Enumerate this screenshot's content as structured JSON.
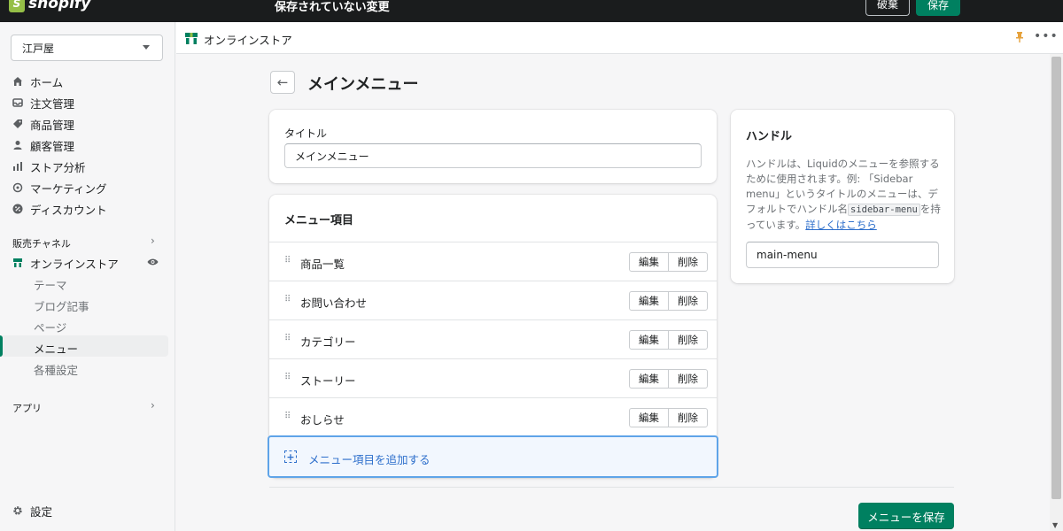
{
  "topbar": {
    "logo_text": "shopify",
    "logo_mark": "S",
    "unsaved_text": "保存されていない変更",
    "discard_label": "破棄",
    "save_label": "保存"
  },
  "sidebar": {
    "store_name": "江戸屋",
    "items": [
      {
        "label": "ホーム",
        "icon": "home-icon"
      },
      {
        "label": "注文管理",
        "icon": "inbox-icon"
      },
      {
        "label": "商品管理",
        "icon": "tag-icon"
      },
      {
        "label": "顧客管理",
        "icon": "person-icon"
      },
      {
        "label": "ストア分析",
        "icon": "bar-chart-icon"
      },
      {
        "label": "マーケティング",
        "icon": "target-icon"
      },
      {
        "label": "ディスカウント",
        "icon": "discount-icon"
      }
    ],
    "sales_channels_label": "販売チャネル",
    "online_store_label": "オンラインストア",
    "sub_items": [
      "テーマ",
      "ブログ記事",
      "ページ",
      "メニュー",
      "各種設定"
    ],
    "active_sub_item": "メニュー",
    "apps_label": "アプリ",
    "settings_label": "設定"
  },
  "header": {
    "title": "オンラインストア"
  },
  "page": {
    "back_icon": "←",
    "title": "メインメニュー"
  },
  "title_card": {
    "label": "タイトル",
    "value": "メインメニュー"
  },
  "items_card": {
    "heading": "メニュー項目",
    "edit_label": "編集",
    "delete_label": "削除",
    "items": [
      "商品一覧",
      "お問い合わせ",
      "カテゴリー",
      "ストーリー",
      "おしらせ"
    ],
    "add_label": "メニュー項目を追加する"
  },
  "handle_card": {
    "heading": "ハンドル",
    "desc_part1": "ハンドルは、Liquidのメニューを参照するために使用されます。例: 「Sidebar menu」というタイトルのメニューは、デフォルトでハンドル名",
    "desc_code": "sidebar-menu",
    "desc_part2": "を持っています。",
    "learn_more": "詳しくはこちら",
    "value": "main-menu"
  },
  "footer": {
    "save_menu_label": "メニューを保存"
  },
  "colors": {
    "accent": "#008060",
    "link": "#2c6ecb",
    "topbar": "#1a1c1d"
  }
}
